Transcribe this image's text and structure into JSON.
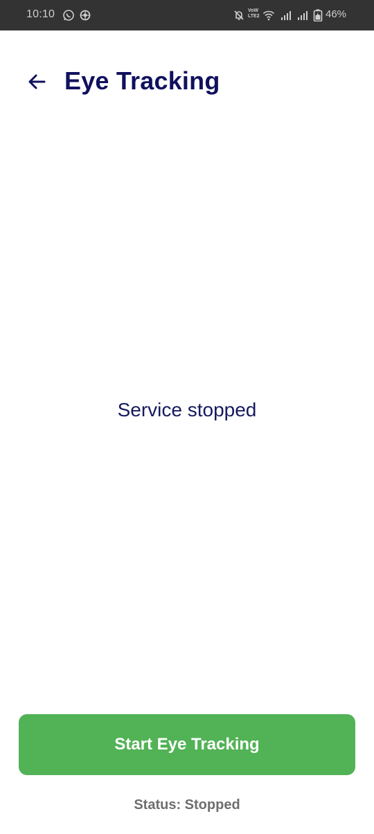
{
  "status_bar": {
    "time": "10:10",
    "network_label_top": "VoW",
    "network_label_bottom": "LTE2",
    "battery_percent": "46%",
    "icons": [
      "whatsapp-icon",
      "settings-notification-icon",
      "mute-icon",
      "vowifi-icon",
      "wifi-icon",
      "signal-icon",
      "signal-icon",
      "battery-icon"
    ]
  },
  "app_bar": {
    "back_icon": "arrow-back-icon",
    "title": "Eye Tracking"
  },
  "main": {
    "message": "Service stopped"
  },
  "actions": {
    "start_label": "Start Eye Tracking"
  },
  "footer": {
    "status": "Status: Stopped"
  },
  "colors": {
    "status_bar_bg": "#333333",
    "title": "#10115e",
    "button": "#52b256",
    "status_text": "#6e6e6e"
  }
}
